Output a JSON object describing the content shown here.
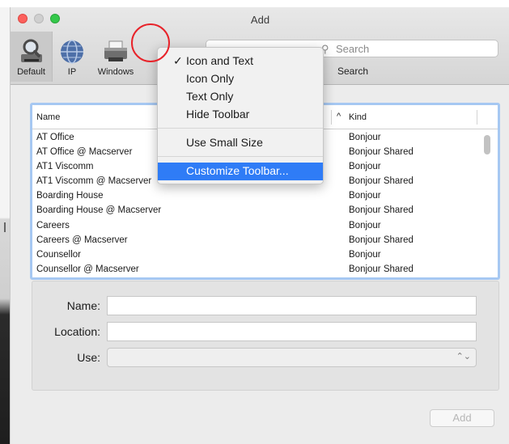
{
  "window": {
    "title": "Add"
  },
  "toolbar": {
    "items": [
      {
        "label": "Default",
        "icon": "magnifier-printer-icon",
        "selected": true
      },
      {
        "label": "IP",
        "icon": "globe-icon"
      },
      {
        "label": "Windows",
        "icon": "printer-icon"
      }
    ],
    "search": {
      "placeholder": "Search",
      "label": "Search",
      "icon": "search-icon"
    }
  },
  "context_menu": {
    "items": [
      {
        "label": "Icon and Text",
        "checked": true,
        "check": "✓"
      },
      {
        "label": "Icon Only"
      },
      {
        "label": "Text Only"
      },
      {
        "label": "Hide Toolbar"
      },
      {
        "label": "Use Small Size"
      },
      {
        "label": "Customize Toolbar...",
        "highlighted": true
      }
    ]
  },
  "table": {
    "columns": {
      "name": "Name",
      "kind": "Kind",
      "sort_indicator": "^"
    },
    "rows": [
      {
        "name": "AT Office",
        "kind": "Bonjour"
      },
      {
        "name": "AT Office @ Macserver",
        "kind": "Bonjour Shared"
      },
      {
        "name": "AT1 Viscomm",
        "kind": "Bonjour"
      },
      {
        "name": "AT1 Viscomm @ Macserver",
        "kind": "Bonjour Shared"
      },
      {
        "name": "Boarding House",
        "kind": "Bonjour"
      },
      {
        "name": "Boarding House @ Macserver",
        "kind": "Bonjour Shared"
      },
      {
        "name": "Careers",
        "kind": "Bonjour"
      },
      {
        "name": "Careers @ Macserver",
        "kind": "Bonjour Shared"
      },
      {
        "name": "Counsellor",
        "kind": "Bonjour"
      },
      {
        "name": "Counsellor @ Macserver",
        "kind": "Bonjour Shared"
      }
    ]
  },
  "form": {
    "name_label": "Name:",
    "name_value": "",
    "location_label": "Location:",
    "location_value": "",
    "use_label": "Use:",
    "use_value": "",
    "use_arrows": "⌃⌄"
  },
  "add_button": {
    "label": "Add"
  },
  "colors": {
    "accent": "#2f7cf6",
    "table_focus": "#a6c8f2",
    "annotation": "#e8232a",
    "close": "#fc605c",
    "maximize": "#34c84a"
  }
}
